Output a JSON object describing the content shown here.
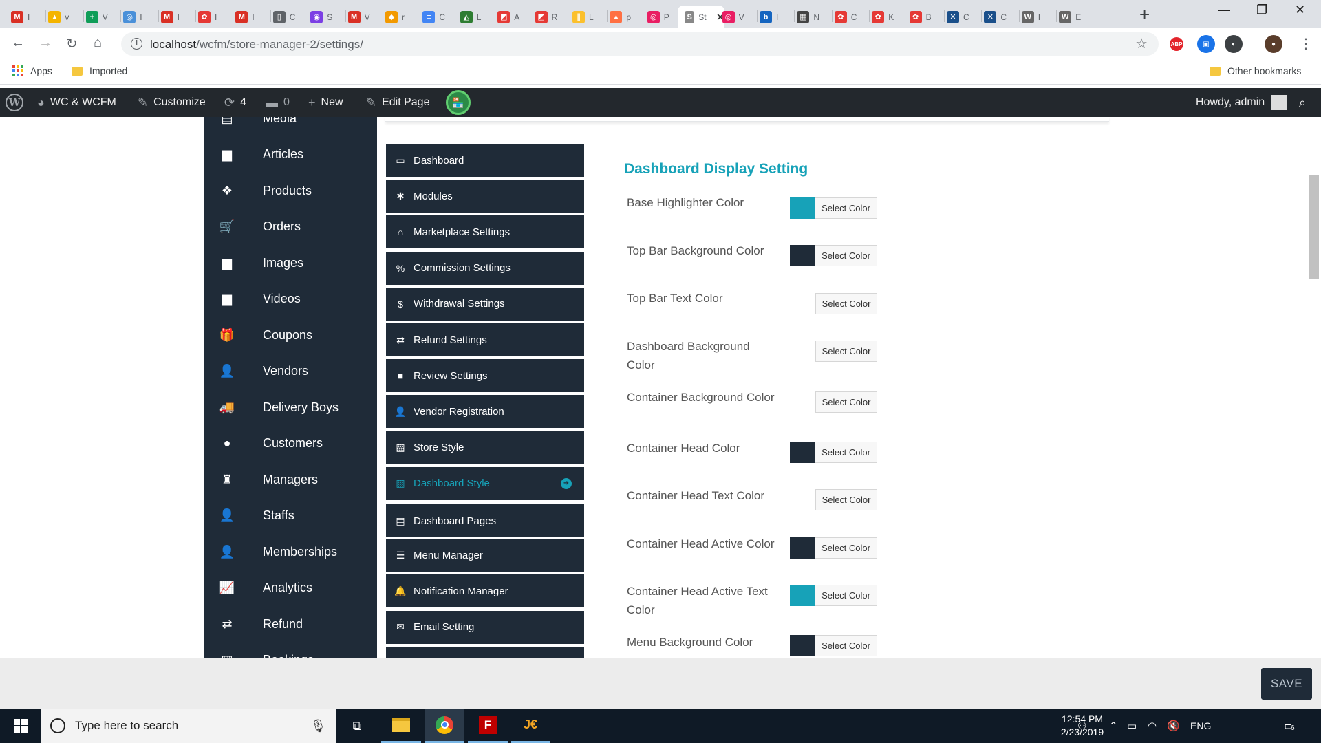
{
  "browser": {
    "tabs": [
      {
        "icon": "gmail-icon",
        "color": "#d93025",
        "glyph": "M",
        "label": "I"
      },
      {
        "icon": "drive-icon",
        "color": "#f4b400",
        "glyph": "▲",
        "label": "v"
      },
      {
        "icon": "sheets-icon",
        "color": "#0f9d58",
        "glyph": "+",
        "label": "V"
      },
      {
        "icon": "app-icon",
        "color": "#4a90d9",
        "glyph": "◎",
        "label": "I"
      },
      {
        "icon": "gmail-icon",
        "color": "#d93025",
        "glyph": "M",
        "label": "I"
      },
      {
        "icon": "wcfm-icon",
        "color": "#e53935",
        "glyph": "✿",
        "label": "I"
      },
      {
        "icon": "gmail-icon",
        "color": "#d93025",
        "glyph": "M",
        "label": "I"
      },
      {
        "icon": "doc-icon",
        "color": "#5f6368",
        "glyph": "▯",
        "label": "C"
      },
      {
        "icon": "app-icon",
        "color": "#7b3fe4",
        "glyph": "◉",
        "label": "S"
      },
      {
        "icon": "gmail-icon",
        "color": "#d93025",
        "glyph": "M",
        "label": "V"
      },
      {
        "icon": "app-icon",
        "color": "#f29900",
        "glyph": "◆",
        "label": "r"
      },
      {
        "icon": "docs-icon",
        "color": "#4285f4",
        "glyph": "≡",
        "label": "C"
      },
      {
        "icon": "app-icon",
        "color": "#2e7d32",
        "glyph": "◭",
        "label": "L"
      },
      {
        "icon": "app-icon",
        "color": "#e53935",
        "glyph": "◩",
        "label": "A"
      },
      {
        "icon": "app-icon",
        "color": "#e53935",
        "glyph": "◩",
        "label": "R"
      },
      {
        "icon": "app-icon",
        "color": "#fbc02d",
        "glyph": "∥",
        "label": "L"
      },
      {
        "icon": "app-icon",
        "color": "#ff7043",
        "glyph": "▲",
        "label": "p"
      },
      {
        "icon": "app-icon",
        "color": "#e91e63",
        "glyph": "◎",
        "label": "P"
      },
      {
        "icon": "app-icon",
        "color": "#888888",
        "glyph": "S",
        "label": "St",
        "active": true
      },
      {
        "icon": "app-icon",
        "color": "#e91e63",
        "glyph": "◎",
        "label": "V"
      },
      {
        "icon": "app-icon",
        "color": "#1565c0",
        "glyph": "b",
        "label": "I"
      },
      {
        "icon": "app-icon",
        "color": "#444444",
        "glyph": "▦",
        "label": "N"
      },
      {
        "icon": "wcfm-icon",
        "color": "#e53935",
        "glyph": "✿",
        "label": "C"
      },
      {
        "icon": "wcfm-icon",
        "color": "#e53935",
        "glyph": "✿",
        "label": "K"
      },
      {
        "icon": "wcfm-icon",
        "color": "#e53935",
        "glyph": "✿",
        "label": "B"
      },
      {
        "icon": "app-icon",
        "color": "#1a4f8a",
        "glyph": "✕",
        "label": "C"
      },
      {
        "icon": "app-icon",
        "color": "#1a4f8a",
        "glyph": "✕",
        "label": "C"
      },
      {
        "icon": "wordpress-icon",
        "color": "#666666",
        "glyph": "W",
        "label": "I"
      },
      {
        "icon": "wordpress-icon",
        "color": "#666666",
        "glyph": "W",
        "label": "E"
      }
    ],
    "url_host": "localhost",
    "url_path": "/wcfm/store-manager-2/settings/",
    "bookmarks": {
      "apps": "Apps",
      "imported": "Imported",
      "other": "Other bookmarks"
    },
    "extensions": [
      {
        "name": "abp-icon",
        "label": "ABP",
        "color": "#e3242b"
      },
      {
        "name": "screenshot-icon",
        "label": "▣",
        "color": "#1a73e8"
      },
      {
        "name": "vpn-icon",
        "label": "◐",
        "color": "#3c4043"
      },
      {
        "name": "profile-avatar-icon",
        "label": "●",
        "color": "#5a3d2b"
      }
    ]
  },
  "wpbar": {
    "site_name": "WC & WCFM",
    "customize": "Customize",
    "updates_count": "4",
    "comments_count": "0",
    "new_label": "New",
    "edit_page": "Edit Page",
    "howdy": "Howdy, admin"
  },
  "wcfm_menu": [
    {
      "label": "Media",
      "icon": "media-icon",
      "glyph": "▤"
    },
    {
      "label": "Articles",
      "icon": "articles-icon",
      "glyph": "▆"
    },
    {
      "label": "Products",
      "icon": "products-icon",
      "glyph": "❖"
    },
    {
      "label": "Orders",
      "icon": "orders-icon",
      "glyph": "🛒"
    },
    {
      "label": "Images",
      "icon": "images-icon",
      "glyph": "▆"
    },
    {
      "label": "Videos",
      "icon": "videos-icon",
      "glyph": "▆"
    },
    {
      "label": "Coupons",
      "icon": "coupons-icon",
      "glyph": "🎁"
    },
    {
      "label": "Vendors",
      "icon": "vendors-icon",
      "glyph": "👤"
    },
    {
      "label": "Delivery Boys",
      "icon": "delivery-icon",
      "glyph": "🚚"
    },
    {
      "label": "Customers",
      "icon": "customers-icon",
      "glyph": "●"
    },
    {
      "label": "Managers",
      "icon": "managers-icon",
      "glyph": "♜"
    },
    {
      "label": "Staffs",
      "icon": "staffs-icon",
      "glyph": "👤"
    },
    {
      "label": "Memberships",
      "icon": "memberships-icon",
      "glyph": "👤"
    },
    {
      "label": "Analytics",
      "icon": "analytics-icon",
      "glyph": "📈"
    },
    {
      "label": "Refund",
      "icon": "refund-icon",
      "glyph": "⇄"
    },
    {
      "label": "Bookings",
      "icon": "bookings-icon",
      "glyph": "▦"
    }
  ],
  "settings_nav": [
    {
      "label": "Dashboard",
      "icon": "monitor-icon",
      "glyph": "▭"
    },
    {
      "label": "Modules",
      "icon": "modules-icon",
      "glyph": "✱"
    },
    {
      "label": "Marketplace Settings",
      "icon": "home-icon",
      "glyph": "⌂"
    },
    {
      "label": "Commission Settings",
      "icon": "percent-icon",
      "glyph": "%"
    },
    {
      "label": "Withdrawal Settings",
      "icon": "dollar-icon",
      "glyph": "$"
    },
    {
      "label": "Refund Settings",
      "icon": "refund-icon",
      "glyph": "⇄"
    },
    {
      "label": "Review Settings",
      "icon": "comment-icon",
      "glyph": "■"
    },
    {
      "label": "Vendor Registration",
      "icon": "user-icon",
      "glyph": "👤"
    },
    {
      "label": "Store Style",
      "icon": "image-icon",
      "glyph": "▨"
    },
    {
      "label": "Dashboard Style",
      "icon": "image-icon",
      "glyph": "▨",
      "active": true
    },
    {
      "label": "Dashboard Pages",
      "icon": "pages-icon",
      "glyph": "▤"
    },
    {
      "label": "Menu Manager",
      "icon": "bars-icon",
      "glyph": "☰"
    },
    {
      "label": "Notification Manager",
      "icon": "bell-icon",
      "glyph": "🔔"
    },
    {
      "label": "Email Setting",
      "icon": "envelope-icon",
      "glyph": "✉"
    },
    {
      "label": "",
      "icon": "more-icon",
      "glyph": ""
    }
  ],
  "dashboard_display": {
    "title": "Dashboard Display Setting",
    "button_label": "Select Color",
    "settings": [
      {
        "label": "Base Highlighter Color",
        "color": "#17a2b8"
      },
      {
        "label": "Top Bar Background Color",
        "color": "#1f2b38"
      },
      {
        "label": "Top Bar Text Color",
        "color": ""
      },
      {
        "label": "Dashboard Background Color",
        "color": ""
      },
      {
        "label": "Container Background Color",
        "color": ""
      },
      {
        "label": "Container Head Color",
        "color": "#1f2b38"
      },
      {
        "label": "Container Head Text Color",
        "color": ""
      },
      {
        "label": "Container Head Active Color",
        "color": "#1f2b38"
      },
      {
        "label": "Container Head Active Text Color",
        "color": "#17a2b8"
      },
      {
        "label": "Menu Background Color",
        "color": "#1f2b38"
      }
    ]
  },
  "save_label": "SAVE",
  "taskbar": {
    "search_placeholder": "Type here to search",
    "language": "ENG",
    "time": "12:54 PM",
    "date": "2/23/2019",
    "notifications": "6"
  },
  "colors": {
    "accent": "#17a2b8",
    "menu_bg": "#1f2b38",
    "wpbar_bg": "#23282d"
  }
}
